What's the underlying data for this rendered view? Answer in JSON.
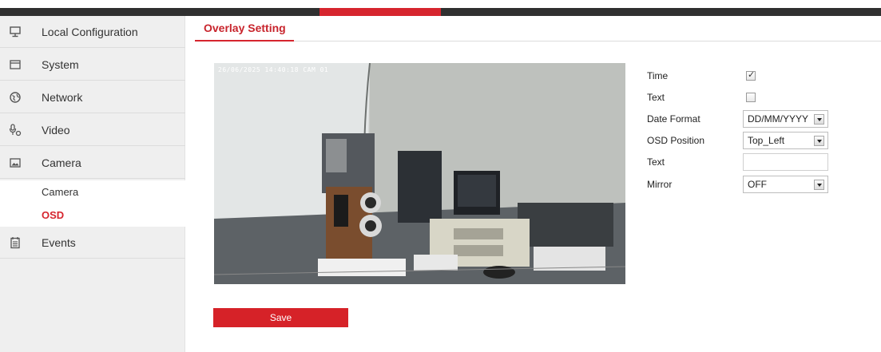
{
  "nav": {
    "items": [
      {
        "label": "Local Configuration",
        "icon": "monitor-icon"
      },
      {
        "label": "System",
        "icon": "window-icon"
      },
      {
        "label": "Network",
        "icon": "globe-icon"
      },
      {
        "label": "Video",
        "icon": "microphone-icon"
      },
      {
        "label": "Camera",
        "icon": "image-icon"
      },
      {
        "label": "Events",
        "icon": "calendar-icon"
      }
    ],
    "sub_items": [
      {
        "label": "Camera",
        "active": false
      },
      {
        "label": "OSD",
        "active": true
      }
    ]
  },
  "main": {
    "tab": "Overlay Setting",
    "preview": {
      "osd_text": "26/06/2025 14:40:18 CAM 01"
    },
    "form": {
      "time_label": "Time",
      "time_checked": true,
      "text_checkbox_label": "Text",
      "text_checked": false,
      "date_format_label": "Date Format",
      "date_format_value": "DD/MM/YYYY",
      "osd_position_label": "OSD Position",
      "osd_position_value": "Top_Left",
      "text_field_label": "Text",
      "text_field_value": "",
      "mirror_label": "Mirror",
      "mirror_value": "OFF"
    },
    "save_label": "Save"
  },
  "colors": {
    "accent": "#d6252e",
    "topbar": "#303030",
    "sidebar_bg": "#efefef"
  }
}
